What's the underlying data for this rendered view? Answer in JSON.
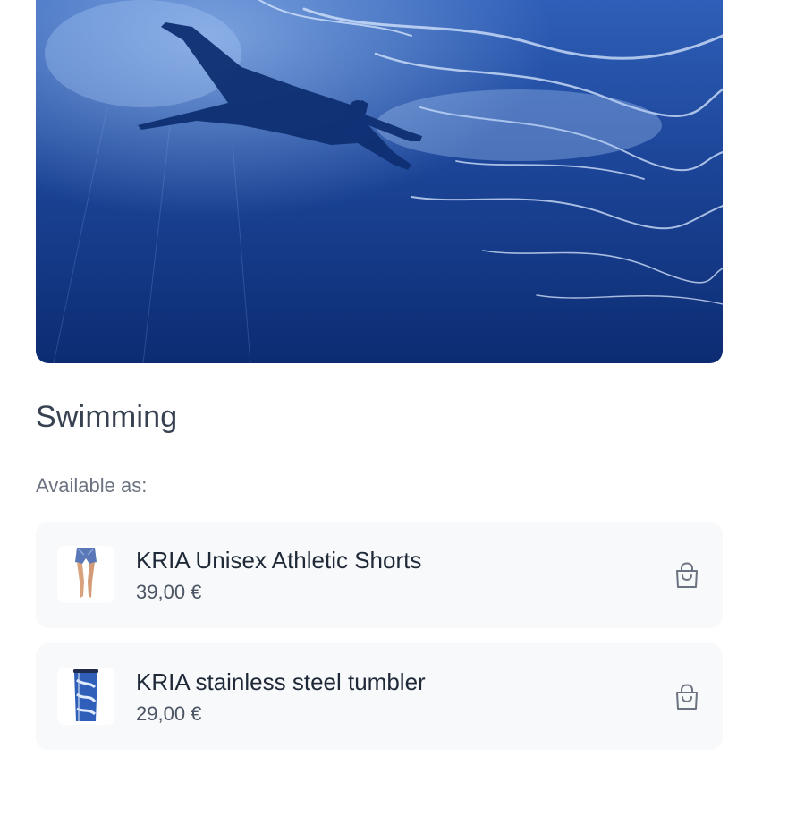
{
  "hero": {
    "image": "underwater-swimmer-photo"
  },
  "title": "Swimming",
  "available_label": "Available as:",
  "products": [
    {
      "name": "KRIA Unisex Athletic Shorts",
      "price": "39,00 €",
      "thumbnail": "athletic-shorts-thumbnail",
      "action_icon": "shopping-bag-icon"
    },
    {
      "name": "KRIA stainless steel tumbler",
      "price": "29,00 €",
      "thumbnail": "tumbler-thumbnail",
      "action_icon": "shopping-bag-icon"
    }
  ],
  "colors": {
    "water_deep": "#0b2a6e",
    "water_light": "#3f6fc4",
    "card_bg": "#f8f9fb",
    "title": "#374151",
    "muted": "#6b7280"
  }
}
